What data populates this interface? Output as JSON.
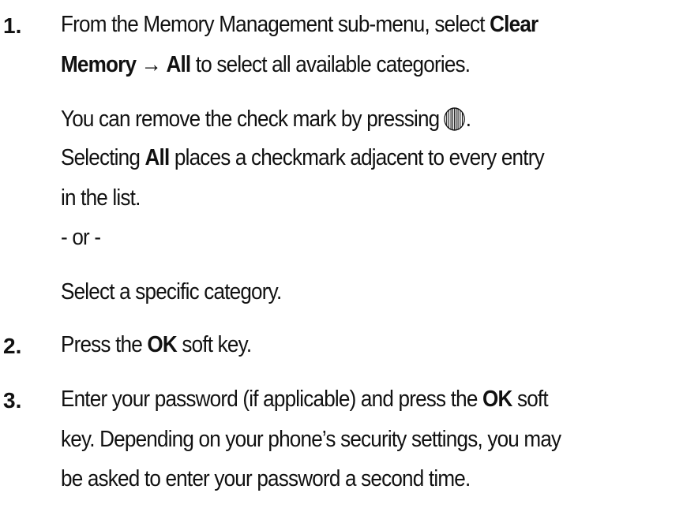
{
  "steps": [
    {
      "number": "1.",
      "line1": {
        "pre": "From the Memory Management sub-menu, select ",
        "bold": "Clear"
      },
      "line2": {
        "bold1": "Memory",
        "arrow": "→",
        "bold2": "All",
        "post": " to select all available categories."
      },
      "note": {
        "pre": "You can remove the check mark by pressing",
        "icon": "navigation-key-icon",
        "post": "."
      },
      "detail_line1": {
        "pre": "Selecting ",
        "bold": "All",
        "post": " places a checkmark adjacent to every entry"
      },
      "detail_line2": "in the list.",
      "or": "- or -",
      "alt": "Select a specific category."
    },
    {
      "number": "2.",
      "pre": "Press the ",
      "bold": "OK",
      "post": " soft key."
    },
    {
      "number": "3.",
      "line1": {
        "pre": "Enter your password (if applicable) and press the ",
        "bold": "OK",
        "post": " soft"
      },
      "line2": "key. Depending on your phone’s security settings, you may",
      "line3": "be asked to enter your password a second time."
    }
  ]
}
